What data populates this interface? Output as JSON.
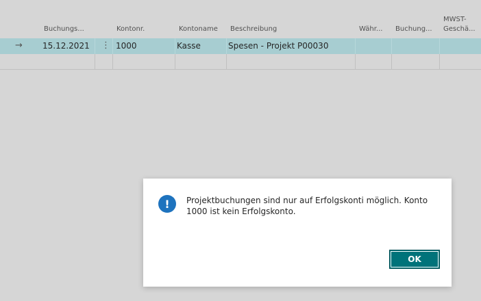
{
  "grid": {
    "columns": [
      {
        "key": "date",
        "label": "Buchungs..."
      },
      {
        "key": "account_no",
        "label": "Kontonr."
      },
      {
        "key": "account_name",
        "label": "Kontoname"
      },
      {
        "key": "description",
        "label": "Beschreibung"
      },
      {
        "key": "currency",
        "label": "Währ..."
      },
      {
        "key": "posting",
        "label": "Buchung..."
      },
      {
        "key": "vat_line1",
        "label": "MWST-"
      },
      {
        "key": "vat_line2",
        "label": "Geschä..."
      }
    ],
    "rows": [
      {
        "date": "15.12.2021",
        "account_no": "1000",
        "account_name": "Kasse",
        "description": "Spesen - Projekt P00030",
        "currency": "",
        "posting": "",
        "vat": ""
      }
    ],
    "row_marker_icon": "arrow-right-icon",
    "row_menu_icon": "more-vertical-icon"
  },
  "dialog": {
    "icon": "exclamation-icon",
    "icon_glyph": "!",
    "message": "Projektbuchungen sind nur auf Erfolgskonti möglich. Konto 1000 ist kein Erfolgskonto.",
    "ok_label": "OK"
  },
  "colors": {
    "selected_row": "#a7cdd1",
    "accent": "#00737a",
    "info_icon": "#1e73be"
  }
}
